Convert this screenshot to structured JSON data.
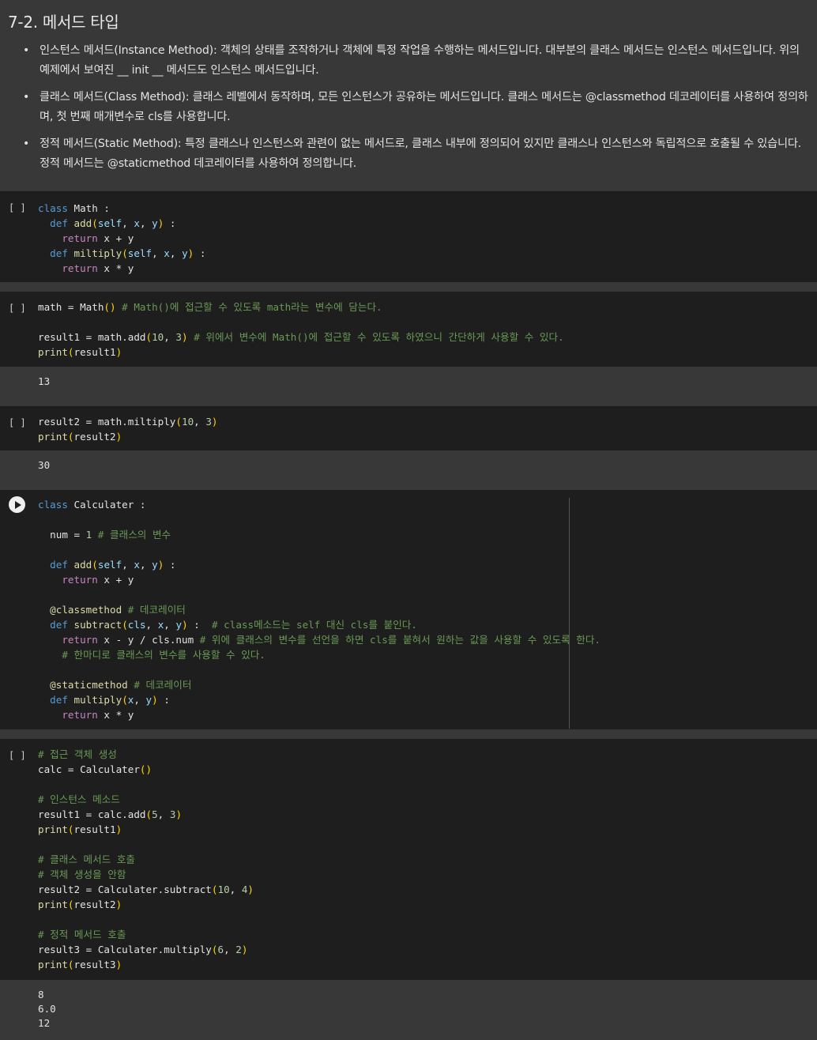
{
  "section": {
    "heading": "7-2. 메서드 타입",
    "bullets": [
      "인스턴스 메서드(Instance Method): 객체의 상태를 조작하거나 객체에 특정 작업을 수행하는 메서드입니다. 대부분의 클래스 메서드는 인스턴스 메서드입니다. 위의 예제에서 보여진 __ init __ 메서드도 인스턴스 메서드입니다.",
      "클래스 메서드(Class Method): 클래스 레벨에서 동작하며, 모든 인스턴스가 공유하는 메서드입니다. 클래스 메서드는 @classmethod 데코레이터를 사용하여 정의하며, 첫 번째 매개변수로 cls를 사용합니다.",
      "정적 메서드(Static Method): 특정 클래스나 인스턴스와 관련이 없는 메서드로, 클래스 내부에 정의되어 있지만 클래스나 인스턴스와 독립적으로 호출될 수 있습니다. 정적 메서드는 @staticmethod 데코레이터를 사용하여 정의합니다."
    ]
  },
  "cells": [
    {
      "run_label": "[ ]",
      "output": ""
    },
    {
      "run_label": "[ ]",
      "output": "13"
    },
    {
      "run_label": "[ ]",
      "output": "30"
    },
    {
      "run_label": "",
      "output": ""
    },
    {
      "run_label": "[ ]",
      "output": "8\n6.0\n12"
    }
  ]
}
